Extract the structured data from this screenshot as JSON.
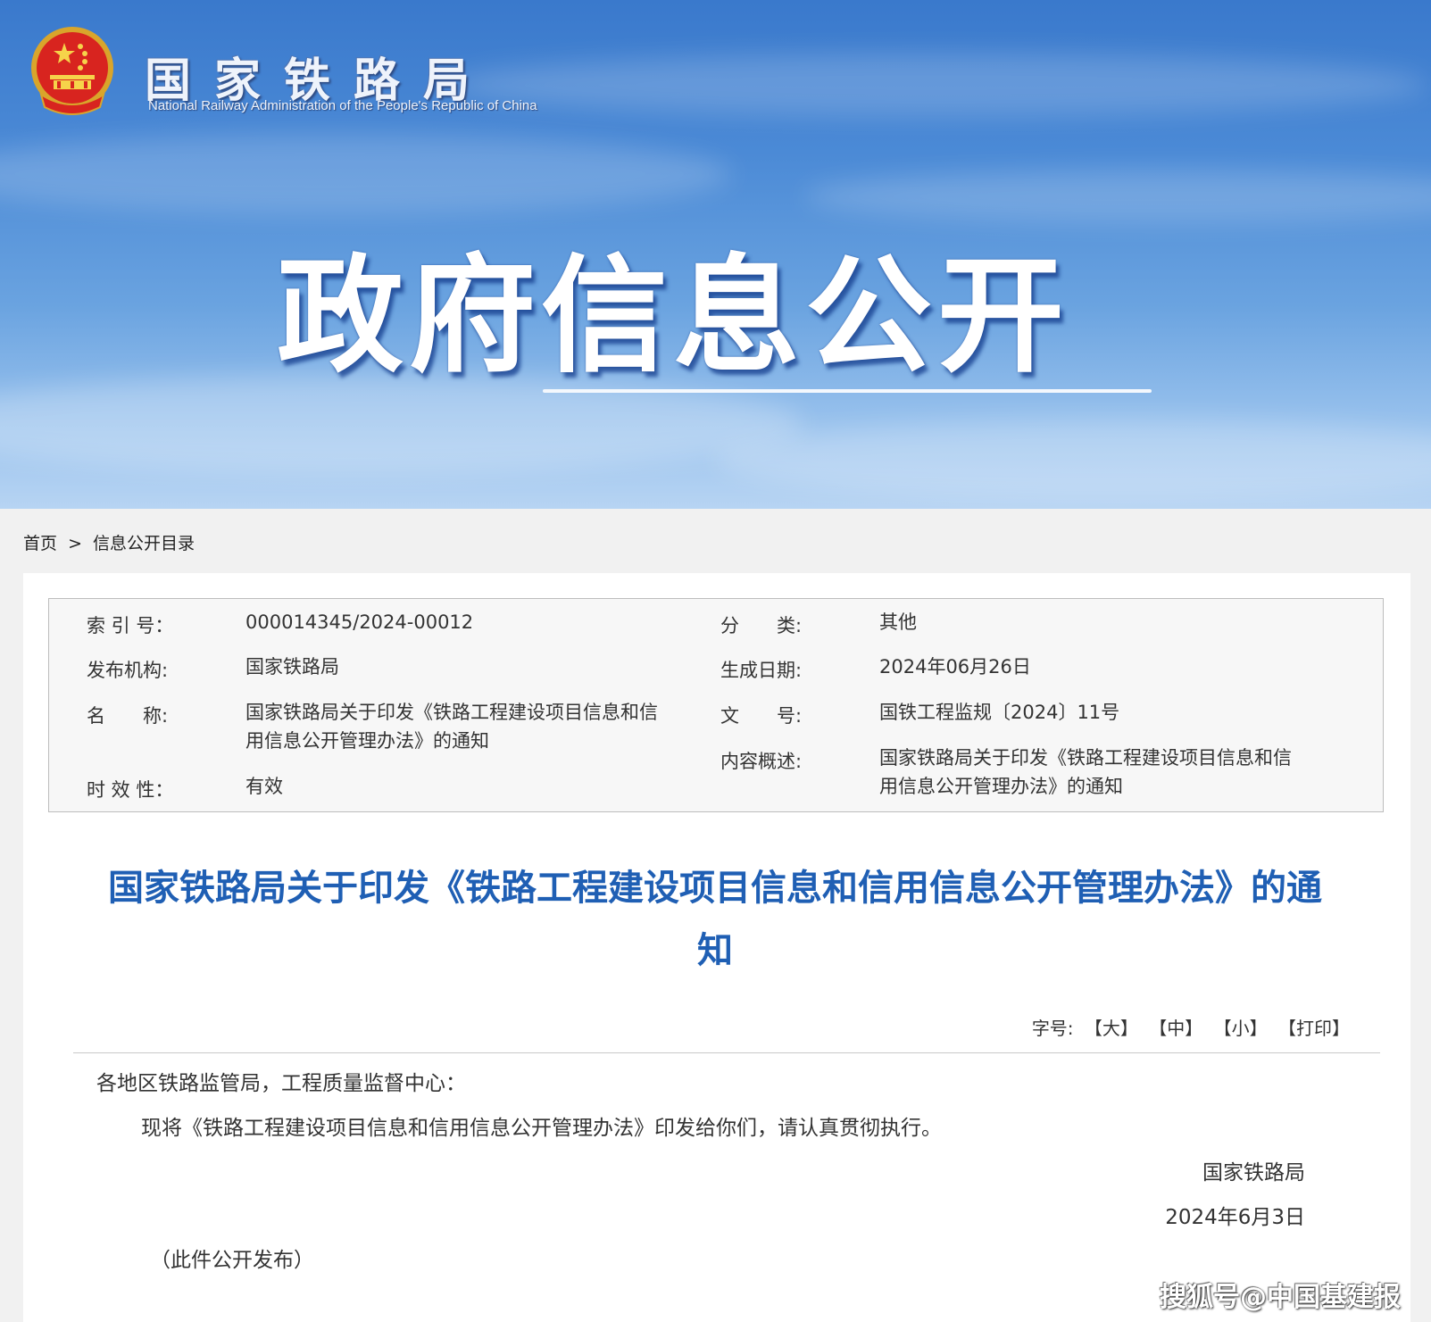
{
  "header": {
    "org_name": "国家铁路局",
    "org_name_en": "National Railway Administration of the People's Republic of China",
    "banner_title": "政府信息公开",
    "emblem_icon": "national-emblem-icon"
  },
  "breadcrumb": {
    "home": "首页",
    "separator": ">",
    "current": "信息公开目录"
  },
  "meta": {
    "index_no_label": "索 引 号：",
    "index_no": "000014345/2024-00012",
    "category_label": "分　　类:",
    "category": "其他",
    "publisher_label": "发布机构:",
    "publisher": "国家铁路局",
    "date_label": "生成日期:",
    "date": "2024年06月26日",
    "name_label": "名　　称:",
    "name_line1": "国家铁路局关于印发《铁路工程建设项目信息和信",
    "name_line2": "用信息公开管理办法》的通知",
    "doc_no_label": "文　　号:",
    "doc_no": "国铁工程监规〔2024〕11号",
    "summary_label": "内容概述:",
    "summary_line1": "国家铁路局关于印发《铁路工程建设项目信息和信",
    "summary_line2": "用信息公开管理办法》的通知",
    "validity_label": "时 效 性：",
    "validity": "有效"
  },
  "document": {
    "title_line1": "国家铁路局关于印发《铁路工程建设项目信息和信用信息公开管理办法》的通",
    "title_line2": "知",
    "font_size_label": "字号:",
    "font_large": "【大】",
    "font_medium": "【中】",
    "font_small": "【小】",
    "print": "【打印】",
    "salutation": "各地区铁路监管局，工程质量监督中心：",
    "body": "现将《铁路工程建设项目信息和信用信息公开管理办法》印发给你们，请认真贯彻执行。",
    "signer": "国家铁路局",
    "sign_date": "2024年6月3日",
    "release_note": "（此件公开发布）"
  },
  "watermark": "搜狐号@中国基建报",
  "colors": {
    "title_blue": "#1f5fb4",
    "banner_blue": "#4b8ad6"
  }
}
